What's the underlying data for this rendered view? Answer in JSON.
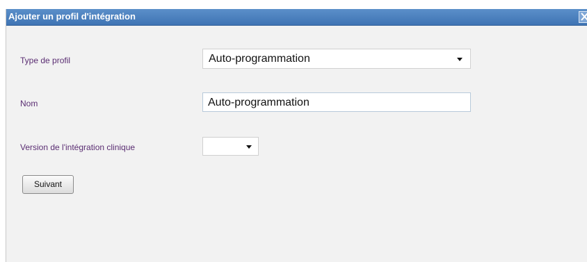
{
  "dialog": {
    "title": "Ajouter un profil d'intégration",
    "close_icon": "close-icon"
  },
  "form": {
    "profile_type": {
      "label": "Type de profil",
      "selected": "Auto-programmation"
    },
    "name": {
      "label": "Nom",
      "value": "Auto-programmation"
    },
    "clinical_version": {
      "label": "Version de l'intégration clinique",
      "selected": ""
    },
    "next_button": "Suivant"
  },
  "colors": {
    "titlebar": "#4a7fbf",
    "label": "#5a2d72",
    "dialog_bg": "#f2f2f2"
  }
}
